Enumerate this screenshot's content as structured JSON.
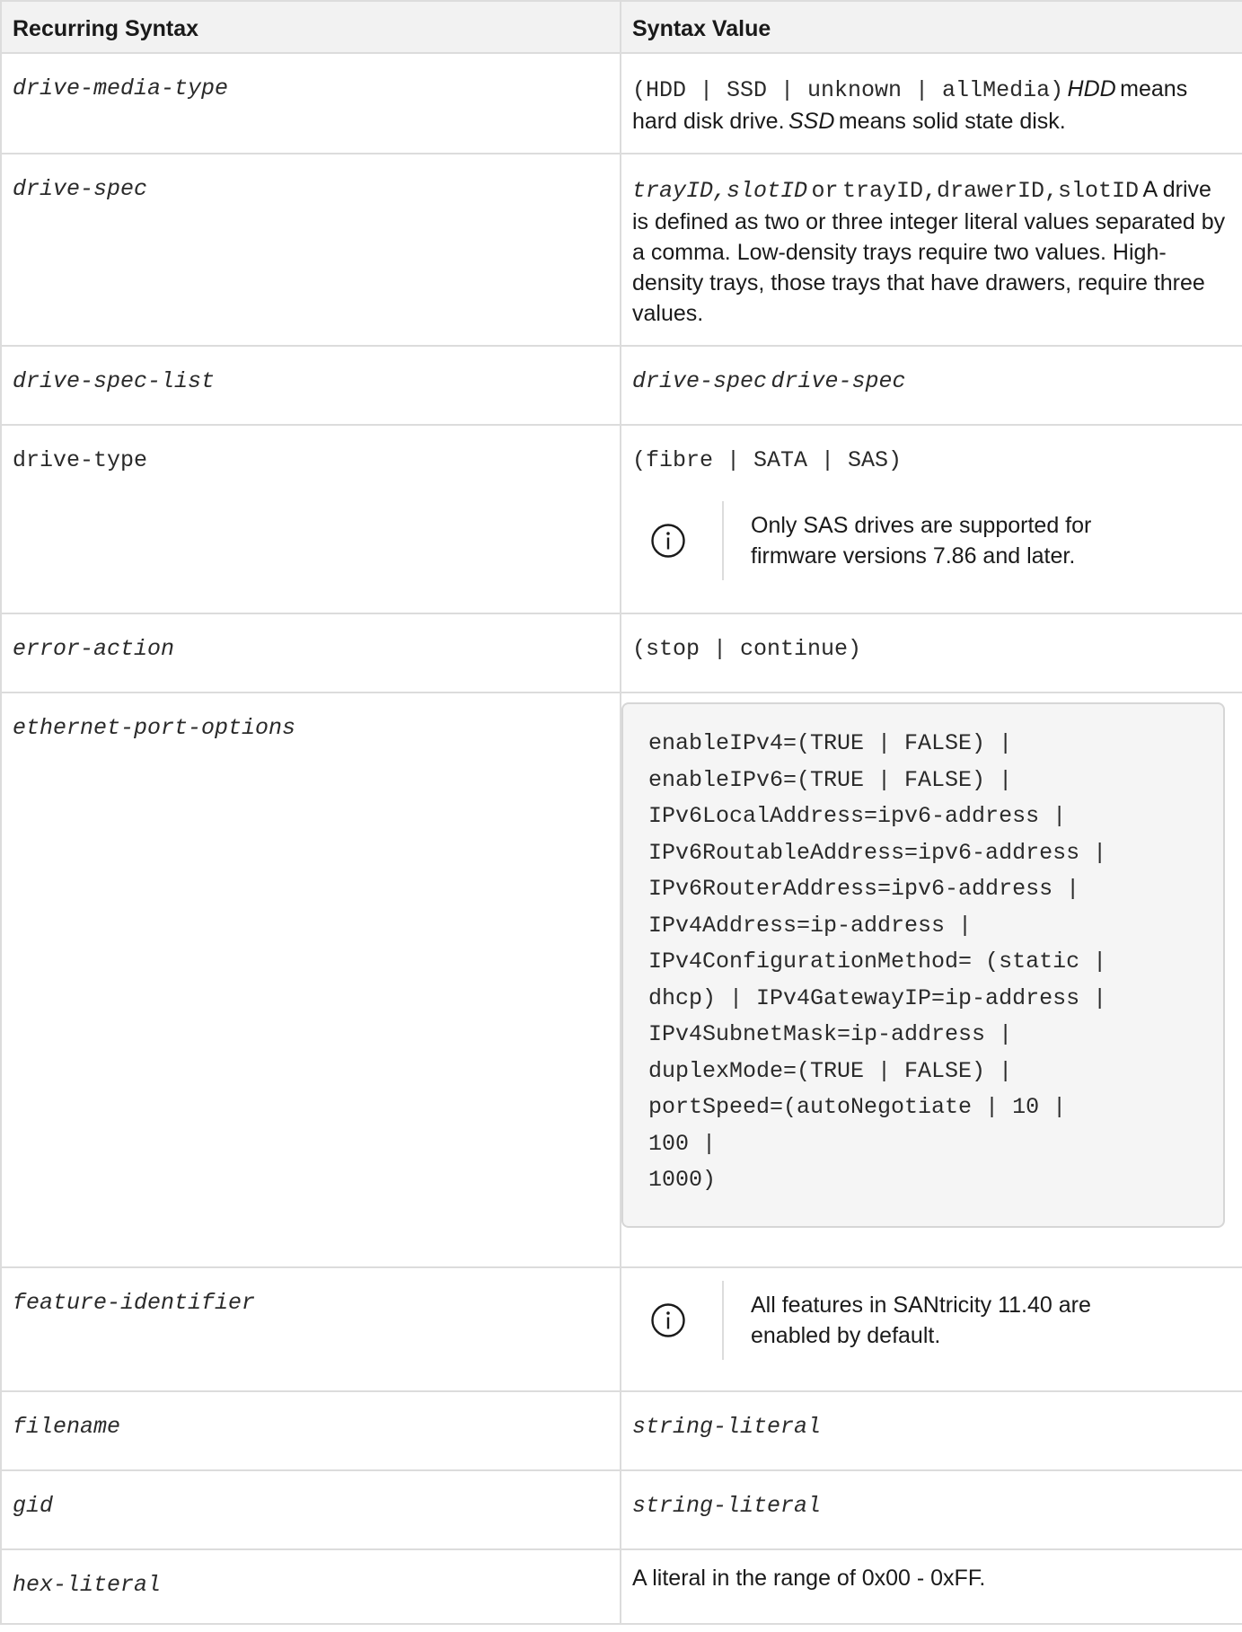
{
  "table": {
    "headers": {
      "col1": "Recurring Syntax",
      "col2": "Syntax Value"
    },
    "rows": {
      "drive_media_type": {
        "name": "drive-media-type",
        "value_code": "(HDD | SSD | unknown | allMedia)",
        "value_em1": "HDD",
        "value_text1": "means hard disk drive.",
        "value_em2": "SSD",
        "value_text2": "means solid state disk."
      },
      "drive_spec": {
        "name": "drive-spec",
        "value_code1": "trayID,slotID",
        "value_or": "or",
        "value_code2": "trayID,drawerID,slotID",
        "value_text": "A drive is defined as two or three integer literal values separated by a comma. Low-density trays require two values. High-density trays, those trays that have drawers, require three values."
      },
      "drive_spec_list": {
        "name": "drive-spec-list",
        "value_code1": "drive-spec",
        "value_code2": "drive-spec"
      },
      "drive_type": {
        "name": "drive-type",
        "value_code": "(fibre | SATA | SAS)",
        "note_icon": "info-circle-icon",
        "note_text": "Only SAS drives are supported for firmware versions 7.86 and later."
      },
      "error_action": {
        "name": "error-action",
        "value_code": "(stop | continue)"
      },
      "ethernet_port_options": {
        "name": "ethernet-port-options",
        "value_code": "enableIPv4=(TRUE | FALSE) |\nenableIPv6=(TRUE | FALSE) |\nIPv6LocalAddress=ipv6-address |\nIPv6RoutableAddress=ipv6-address |\nIPv6RouterAddress=ipv6-address |\nIPv4Address=ip-address |\nIPv4ConfigurationMethod= (static |\ndhcp) | IPv4GatewayIP=ip-address |\nIPv4SubnetMask=ip-address |\nduplexMode=(TRUE | FALSE) |\nportSpeed=(autoNegotiate | 10 |\n100 |\n1000)"
      },
      "feature_identifier": {
        "name": "feature-identifier",
        "note_icon": "info-circle-icon",
        "note_text": "All features in SANtricity 11.40 are enabled by default."
      },
      "filename": {
        "name": "filename",
        "value_code": "string-literal"
      },
      "gid": {
        "name": "gid",
        "value_code": "string-literal"
      },
      "hex_literal": {
        "name": "hex-literal",
        "value_text": "A literal in the range of 0x00 - 0xFF."
      }
    },
    "colors": {
      "border": "#dcdcdc",
      "header_bg": "#f2f2f2",
      "code_bg": "#f5f5f5",
      "icon": "#1a1a1a"
    }
  }
}
